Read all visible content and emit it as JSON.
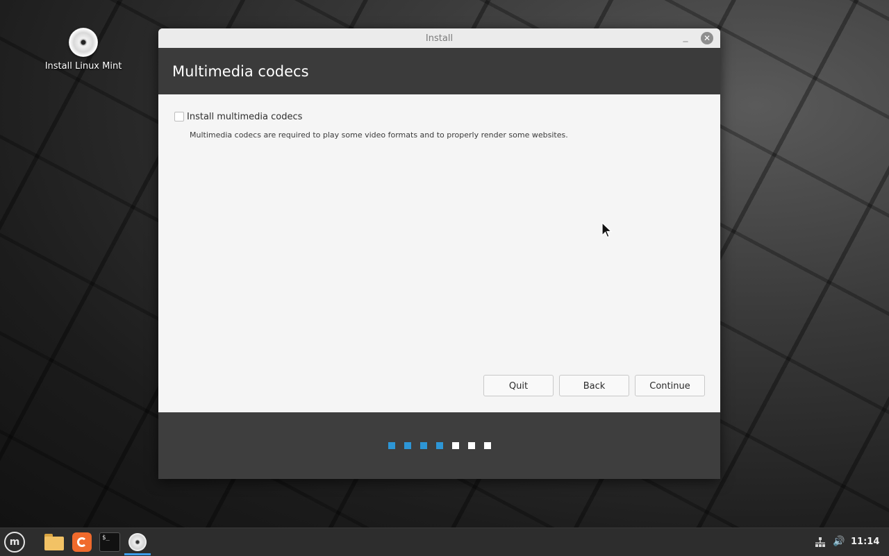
{
  "desktop": {
    "icons": [
      {
        "label": "Install Linux Mint",
        "icon": "disc-icon"
      }
    ]
  },
  "window": {
    "title": "Install",
    "minimize_glyph": "_",
    "close_glyph": "✕",
    "header_title": "Multimedia codecs",
    "checkbox": {
      "label": "Install multimedia codecs",
      "checked": false
    },
    "description": "Multimedia codecs are required to play some video formats and to properly render some websites.",
    "buttons": {
      "quit": "Quit",
      "back": "Back",
      "continue": "Continue"
    },
    "progress": {
      "total_steps": 7,
      "completed_steps": 4,
      "completed_color": "#2d96d6",
      "pending_color": "#ffffff"
    }
  },
  "taskbar": {
    "menu_glyph": "m",
    "apps": [
      "files-icon",
      "firefox-icon",
      "terminal-icon",
      "installer-disc-icon"
    ],
    "terminal_glyph": "$_",
    "active_app": "installer-disc-icon",
    "volume_glyph": "🔊",
    "clock": "11:14",
    "accent": "#3d9be9"
  }
}
